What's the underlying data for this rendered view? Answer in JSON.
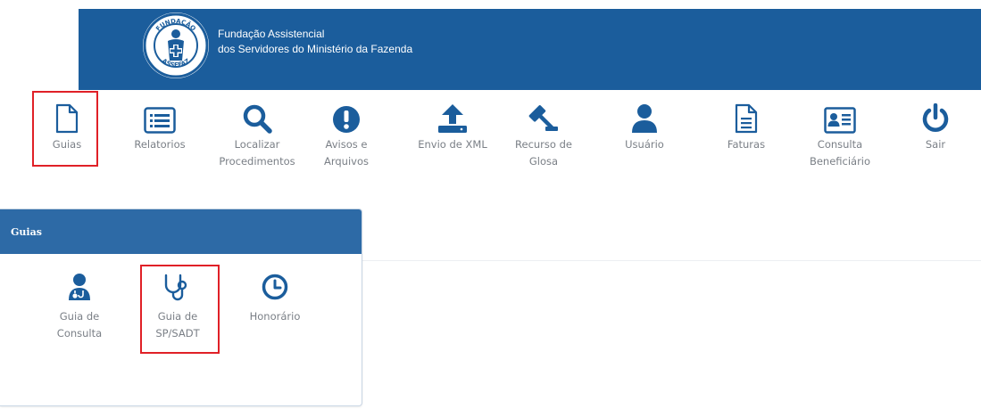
{
  "header": {
    "org_line1": "Fundação Assistencial",
    "org_line2": "dos Servidores do Ministério da Fazenda",
    "logo_text_top": "FUNDAÇÃO",
    "logo_text_bottom": "ASSEFAZ",
    "background": "#1b5d9c"
  },
  "nav": {
    "icon_color": "#1b5d9c",
    "items": [
      {
        "id": "guias",
        "label": "Guias",
        "icon": "document-icon",
        "highlighted": true
      },
      {
        "id": "relatorios",
        "label": "Relatorios",
        "icon": "list-icon"
      },
      {
        "id": "localizar",
        "label_line1": "Localizar",
        "label_line2": "Procedimentos",
        "icon": "search-icon"
      },
      {
        "id": "avisos",
        "label_line1": "Avisos e",
        "label_line2": "Arquivos",
        "icon": "exclamation-icon"
      },
      {
        "id": "envio",
        "label": "Envio de XML",
        "icon": "upload-icon"
      },
      {
        "id": "recurso",
        "label_line1": "Recurso de",
        "label_line2": "Glosa",
        "icon": "gavel-icon"
      },
      {
        "id": "usuario",
        "label": "Usuário",
        "icon": "user-icon"
      },
      {
        "id": "faturas",
        "label": "Faturas",
        "icon": "invoice-icon"
      },
      {
        "id": "consulta",
        "label_line1": "Consulta",
        "label_line2": "Beneficiário",
        "icon": "id-card-icon"
      },
      {
        "id": "sair",
        "label": "Sair",
        "icon": "power-icon"
      }
    ]
  },
  "panel": {
    "title": "Guias",
    "header_color": "#2d6aa6",
    "items": [
      {
        "label_line1": "Guia de",
        "label_line2": "Consulta",
        "icon": "doctor-icon"
      },
      {
        "label_line1": "Guia de",
        "label_line2": "SP/SADT",
        "icon": "stethoscope-icon",
        "highlighted": true
      },
      {
        "label": "Honorário",
        "icon": "clock-icon"
      }
    ]
  },
  "highlight_color": "#e02027"
}
